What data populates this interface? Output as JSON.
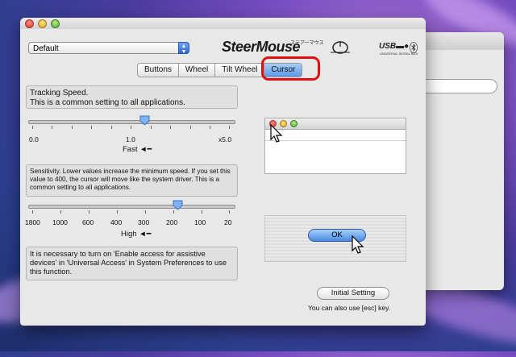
{
  "window": {
    "profile_select": "Default",
    "brand": "SteerMouse",
    "brand_kana": "ステアーマウス",
    "usb_text": "USB",
    "usb_sub": "UNIVERSAL SERIAL BUS"
  },
  "tabs": [
    {
      "label": "Buttons",
      "active": false
    },
    {
      "label": "Wheel",
      "active": false
    },
    {
      "label": "Tilt Wheel",
      "active": false
    },
    {
      "label": "Cursor",
      "active": true
    }
  ],
  "tracking": {
    "description_line1": "Tracking Speed.",
    "description_line2": "This is a common setting to all applications.",
    "tick_labels": [
      "0.0",
      "1.0",
      "x5.0"
    ],
    "axis_label": "Fast",
    "value_fraction": 0.57
  },
  "sensitivity": {
    "description": "Sensitivity. Lower values increase the minimum speed. If you set this value to 400, the cursor will move like the system driver. This is a common setting to all applications.",
    "tick_labels": [
      "1800",
      "1000",
      "600",
      "400",
      "300",
      "200",
      "100",
      "20"
    ],
    "axis_label": "High",
    "value_fraction": 0.74
  },
  "note": "It is necessary to turn on 'Enable access for assistive devices' in 'Universal Access' in System Preferences to use this function.",
  "demo": {
    "ok_label": "OK"
  },
  "footer": {
    "initial_setting_label": "Initial Setting",
    "esc_note": "You can also use [esc] key."
  },
  "colors": {
    "accent_blue": "#5b98e6",
    "highlight_red": "#e01010"
  }
}
